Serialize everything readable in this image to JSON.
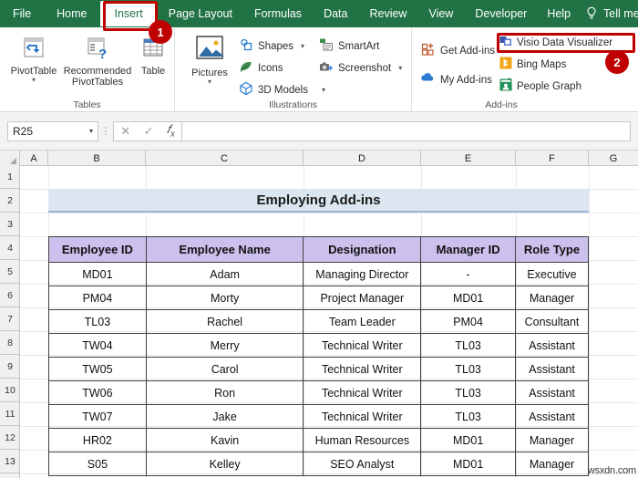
{
  "ribbon": {
    "tabs": [
      {
        "label": "File",
        "active": false
      },
      {
        "label": "Home",
        "active": false
      },
      {
        "label": "Insert",
        "active": true
      },
      {
        "label": "Page Layout",
        "active": false
      },
      {
        "label": "Formulas",
        "active": false
      },
      {
        "label": "Data",
        "active": false
      },
      {
        "label": "Review",
        "active": false
      },
      {
        "label": "View",
        "active": false
      },
      {
        "label": "Developer",
        "active": false
      },
      {
        "label": "Help",
        "active": false
      }
    ],
    "tell_me": "Tell me",
    "tell_me_icon": "lightbulb-icon",
    "groups": [
      {
        "name": "Tables",
        "label": "Tables",
        "buttons": [
          {
            "label": "PivotTable",
            "icon": "pivottable-icon",
            "has_caret": true
          },
          {
            "label": "Recommended PivotTables",
            "icon": "recommended-pivottables-icon",
            "has_caret": false
          },
          {
            "label": "Table",
            "icon": "table-icon",
            "has_caret": false
          }
        ]
      },
      {
        "name": "Illustrations",
        "label": "Illustrations",
        "buttons": [
          {
            "label": "Pictures",
            "icon": "pictures-icon",
            "has_caret": true
          },
          {
            "label": "Shapes",
            "icon": "shapes-icon",
            "has_caret": true
          },
          {
            "label": "Icons",
            "icon": "icons-icon",
            "has_caret": false
          },
          {
            "label": "3D Models",
            "icon": "3d-models-icon",
            "has_caret": true
          },
          {
            "label": "SmartArt",
            "icon": "smartart-icon",
            "has_caret": false
          },
          {
            "label": "Screenshot",
            "icon": "screenshot-icon",
            "has_caret": true
          }
        ]
      },
      {
        "name": "Add-ins",
        "label": "Add-ins",
        "buttons": [
          {
            "label": "Get Add-ins",
            "icon": "get-add-ins-icon",
            "has_caret": false
          },
          {
            "label": "My Add-ins",
            "icon": "my-add-ins-icon",
            "has_caret": true
          },
          {
            "label": "Visio Data Visualizer",
            "icon": "visio-icon",
            "has_caret": false
          },
          {
            "label": "Bing Maps",
            "icon": "bing-maps-icon",
            "has_caret": false
          },
          {
            "label": "People Graph",
            "icon": "people-graph-icon",
            "has_caret": false
          }
        ]
      }
    ]
  },
  "formula_bar": {
    "name_box_value": "R25",
    "name_box_caret_icon": "chevron-down-icon",
    "cancel_icon": "cancel-icon",
    "enter_icon": "check-icon",
    "insert_function_icon": "fx-icon",
    "formula_value": ""
  },
  "grid": {
    "columns": [
      "A",
      "B",
      "C",
      "D",
      "E",
      "F",
      "G"
    ],
    "rows": [
      "1",
      "2",
      "3",
      "4",
      "5",
      "6",
      "7",
      "8",
      "9",
      "10",
      "11",
      "12",
      "13"
    ]
  },
  "sheet": {
    "title": "Employing Add-ins",
    "table": {
      "headers": [
        "Employee ID",
        "Employee Name",
        "Designation",
        "Manager ID",
        "Role Type"
      ],
      "rows": [
        [
          "MD01",
          "Adam",
          "Managing Director",
          "-",
          "Executive"
        ],
        [
          "PM04",
          "Morty",
          "Project Manager",
          "MD01",
          "Manager"
        ],
        [
          "TL03",
          "Rachel",
          "Team Leader",
          "PM04",
          "Consultant"
        ],
        [
          "TW04",
          "Merry",
          "Technical Writer",
          "TL03",
          "Assistant"
        ],
        [
          "TW05",
          "Carol",
          "Technical Writer",
          "TL03",
          "Assistant"
        ],
        [
          "TW06",
          "Ron",
          "Technical Writer",
          "TL03",
          "Assistant"
        ],
        [
          "TW07",
          "Jake",
          "Technical Writer",
          "TL03",
          "Assistant"
        ],
        [
          "HR02",
          "Kavin",
          "Human Resources",
          "MD01",
          "Manager"
        ],
        [
          "S05",
          "Kelley",
          "SEO Analyst",
          "MD01",
          "Manager"
        ]
      ]
    }
  },
  "annotations": {
    "color": "#c00000",
    "badges": [
      {
        "label": "1",
        "target": "insert-tab"
      },
      {
        "label": "2",
        "target": "visio-data-visualizer"
      }
    ]
  },
  "watermark": "wsxdn.com"
}
